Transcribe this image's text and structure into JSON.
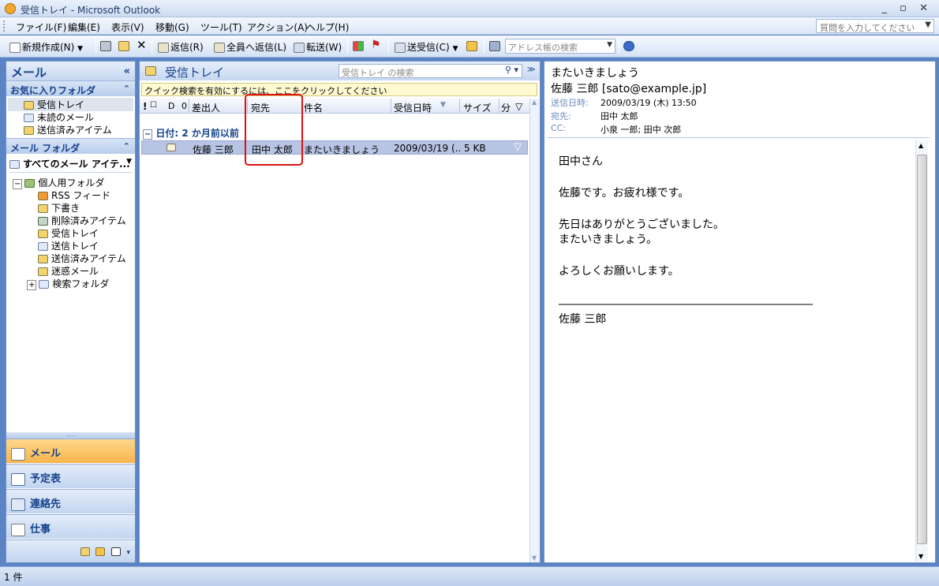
{
  "window": {
    "title": "受信トレイ - Microsoft Outlook",
    "controls": "_ ▫ ✕"
  },
  "menu": {
    "items": [
      "ファイル(F)",
      "編集(E)",
      "表示(V)",
      "移動(G)",
      "ツール(T)",
      "アクション(A)",
      "ヘルプ(H)"
    ],
    "ask_placeholder": "質問を入力してください"
  },
  "toolbar": {
    "new": "新規作成(N)",
    "reply": "返信(R)",
    "reply_all": "全員へ返信(L)",
    "forward": "転送(W)",
    "send_receive": "送受信(C)",
    "address_search": "アドレス帳の検索"
  },
  "nav": {
    "title": "メール",
    "favorites_header": "お気に入りフォルダ",
    "favorites": [
      "受信トレイ",
      "未読のメール",
      "送信済みアイテム"
    ],
    "mailfolders_header": "メール フォルダ",
    "all_items": "すべてのメール アイテ...",
    "root": "個人用フォルダ",
    "folders": [
      "RSS フィード",
      "下書き",
      "削除済みアイテム",
      "受信トレイ",
      "送信トレイ",
      "送信済みアイテム",
      "迷惑メール",
      "検索フォルダ"
    ],
    "buttons": [
      "メール",
      "予定表",
      "連絡先",
      "仕事"
    ],
    "grip": "....."
  },
  "list": {
    "folder_title": "受信トレイ",
    "search_placeholder": "受信トレイ の検索",
    "quick_search_bar": "クイック検索を有効にするには、ここをクリックしてください",
    "columns": {
      "importance": "!",
      "reminder": "☐",
      "icon": "D",
      "attach": "0",
      "from": "差出人",
      "to": "宛先",
      "subject": "件名",
      "received": "受信日時",
      "size": "サイズ",
      "category": "分",
      "flag": "▽"
    },
    "group_label": "日付: 2 か月前以前",
    "messages": [
      {
        "from": "佐藤 三郎",
        "to": "田中 太郎",
        "subject": "またいきましょう",
        "received": "2009/03/19 (…",
        "size": "5 KB"
      }
    ]
  },
  "reading": {
    "subject": "またいきましょう",
    "from": "佐藤 三郎 [sato@example.jp]",
    "sent_label": "送信日時:",
    "sent": "2009/03/19 (木) 13:50",
    "to_label": "宛先:",
    "to": "田中 太郎",
    "cc_label": "CC:",
    "cc": "小泉 一郎; 田中 次郎",
    "body": [
      "田中さん",
      "佐藤です。お疲れ様です。",
      "先日はありがとうございました。",
      "またいきましょう。",
      "よろしくお願いします。",
      "______________________________________________",
      "佐藤 三郎"
    ]
  },
  "status": {
    "count": "1 件"
  }
}
